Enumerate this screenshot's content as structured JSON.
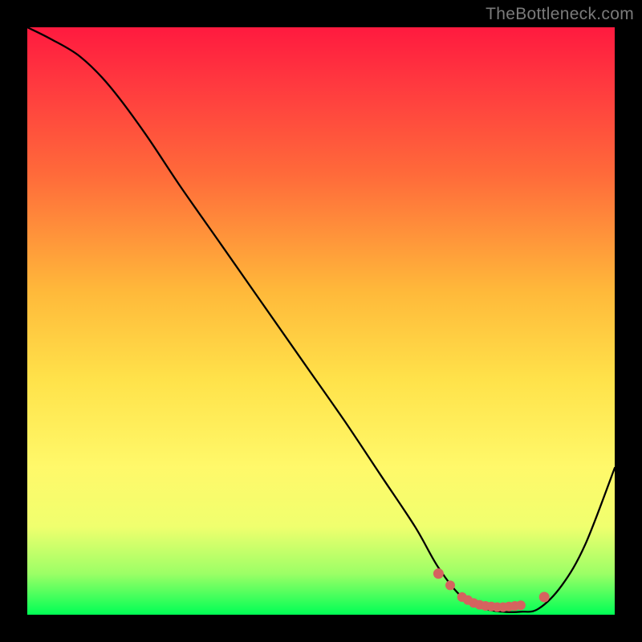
{
  "watermark": "TheBottleneck.com",
  "chart_data": {
    "type": "line",
    "title": "",
    "xlabel": "",
    "ylabel": "",
    "xlim": [
      0,
      100
    ],
    "ylim": [
      0,
      100
    ],
    "series": [
      {
        "name": "bottleneck-curve",
        "x": [
          0,
          4,
          9,
          14,
          20,
          26,
          33,
          40,
          47,
          54,
          60,
          66,
          70,
          74,
          78,
          81,
          84,
          87,
          91,
          95,
          100
        ],
        "y": [
          100,
          98,
          95,
          90,
          82,
          73,
          63,
          53,
          43,
          33,
          24,
          15,
          8,
          3,
          1,
          0.5,
          0.5,
          1,
          5,
          12,
          25
        ]
      },
      {
        "name": "highlight-dots",
        "x": [
          70,
          72,
          74,
          75,
          76,
          77,
          78,
          79,
          80,
          81,
          82,
          83,
          84,
          88
        ],
        "y": [
          7,
          5,
          3,
          2.5,
          2,
          1.7,
          1.5,
          1.4,
          1.3,
          1.3,
          1.4,
          1.5,
          1.6,
          3
        ]
      }
    ],
    "colors": {
      "curve": "#000000",
      "dots": "#d5635f"
    }
  }
}
